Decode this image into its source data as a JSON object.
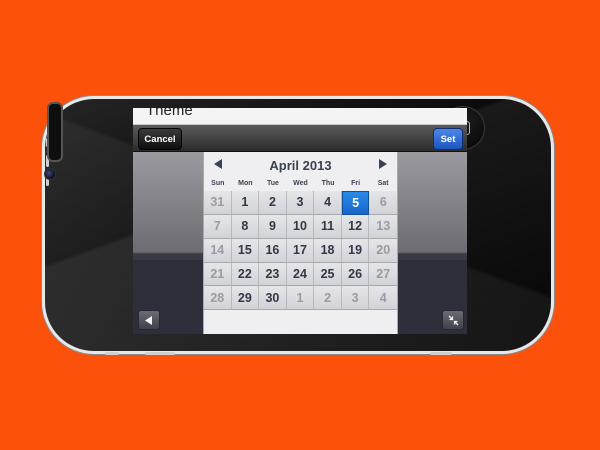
{
  "screen": {
    "theme_label": "Theme"
  },
  "toolbar": {
    "cancel_label": "Cancel",
    "set_label": "Set"
  },
  "calendar": {
    "title": "April 2013",
    "days_of_week": [
      "Sun",
      "Mon",
      "Tue",
      "Wed",
      "Thu",
      "Fri",
      "Sat"
    ],
    "weeks": [
      [
        "31",
        "1",
        "2",
        "3",
        "4",
        "5",
        "6"
      ],
      [
        "7",
        "8",
        "9",
        "10",
        "11",
        "12",
        "13"
      ],
      [
        "14",
        "15",
        "16",
        "17",
        "18",
        "19",
        "20"
      ],
      [
        "21",
        "22",
        "23",
        "24",
        "25",
        "26",
        "27"
      ],
      [
        "28",
        "29",
        "30",
        "1",
        "2",
        "3",
        "4"
      ]
    ],
    "selected_day": "5",
    "colors": {
      "selected": "#1f78dc",
      "background": "#fc510b"
    }
  },
  "icons": {
    "prev": "chevron-left-icon",
    "next": "chevron-right-icon",
    "back": "triangle-left-icon",
    "collapse": "collapse-arrows-icon"
  }
}
